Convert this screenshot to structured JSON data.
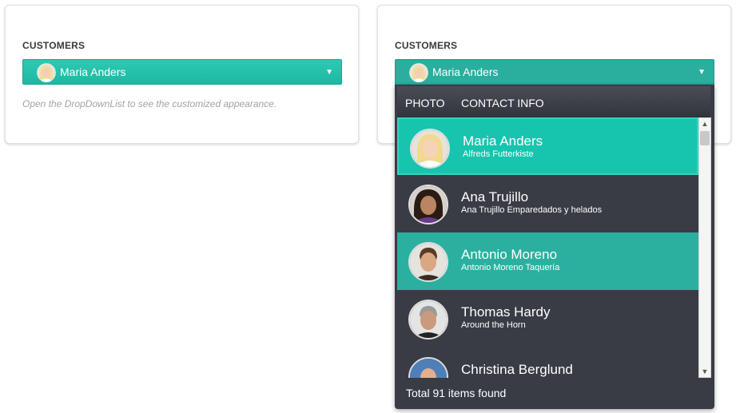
{
  "left_card": {
    "label": "CUSTOMERS",
    "selected_value": "Maria Anders",
    "hint": "Open the DropDownList to see the customized appearance."
  },
  "right_card": {
    "label": "CUSTOMERS",
    "selected_value": "Maria Anders"
  },
  "popup": {
    "header_photo": "PHOTO",
    "header_contact": "CONTACT INFO",
    "items": [
      {
        "name": "Maria Anders",
        "company": "Alfreds Futterkiste",
        "state": "selected"
      },
      {
        "name": "Ana Trujillo",
        "company": "Ana Trujillo Emparedados y helados",
        "state": "normal"
      },
      {
        "name": "Antonio Moreno",
        "company": "Antonio Moreno Taquería",
        "state": "hover"
      },
      {
        "name": "Thomas Hardy",
        "company": "Around the Horn",
        "state": "normal"
      },
      {
        "name": "Christina Berglund",
        "company": "",
        "state": "normal"
      }
    ],
    "footer": "Total 91 items found"
  },
  "icons": {
    "dropdown_arrow": "triangle-down-icon",
    "scroll_up": "chevron-up-icon",
    "scroll_down": "chevron-down-icon"
  },
  "colors": {
    "accent": "#1bb9a3",
    "popup_bg": "#393c45",
    "selected": "#17c4ae",
    "hover": "#2bb0a0"
  }
}
